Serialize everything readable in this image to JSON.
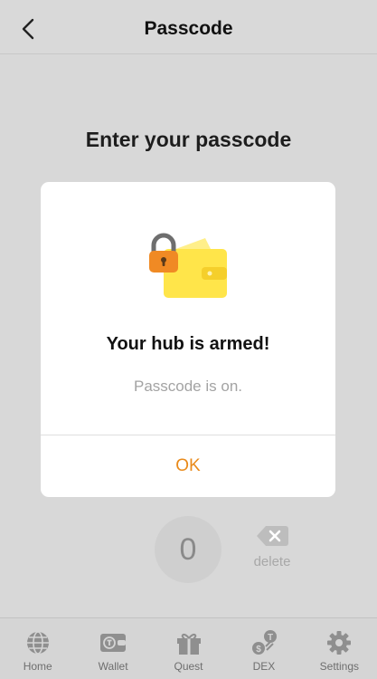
{
  "header": {
    "title": "Passcode"
  },
  "prompt": "Enter your passcode",
  "keypad": {
    "zero": "0",
    "delete_label": "delete"
  },
  "modal": {
    "title": "Your hub is armed!",
    "message": "Passcode is on.",
    "ok_label": "OK"
  },
  "tabs": [
    {
      "label": "Home",
      "icon": "globe-icon"
    },
    {
      "label": "Wallet",
      "icon": "wallet-icon"
    },
    {
      "label": "Quest",
      "icon": "gift-icon"
    },
    {
      "label": "DEX",
      "icon": "exchange-icon"
    },
    {
      "label": "Settings",
      "icon": "gear-icon"
    }
  ],
  "colors": {
    "accent": "#e98a1a",
    "lock": "#f08a24",
    "wallet": "#ffe54a"
  }
}
